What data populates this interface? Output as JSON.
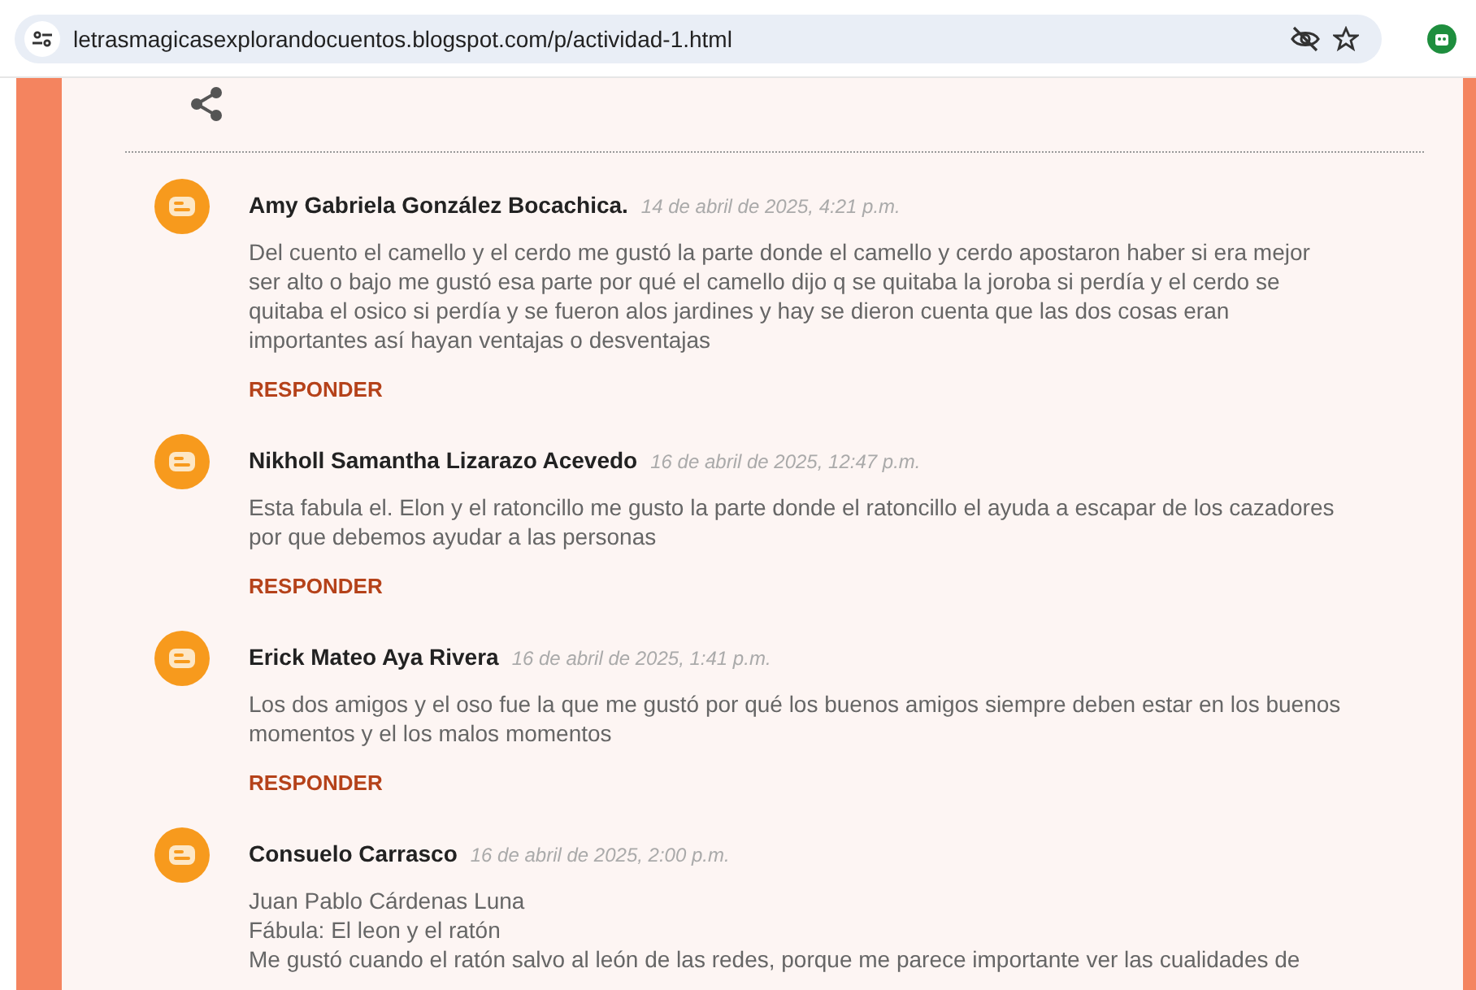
{
  "address_bar": {
    "url": "letrasmagicasexplorandocuentos.blogspot.com/p/actividad-1.html"
  },
  "comments": [
    {
      "author": "Amy Gabriela González Bocachica.",
      "date": "14 de abril de 2025, 4:21 p.m.",
      "text": "Del cuento el camello y el cerdo me gustó la parte donde el camello y cerdo apostaron haber si era mejor ser alto o bajo me gustó esa parte por qué el camello dijo q se quitaba la joroba si perdía y el cerdo se quitaba el osico si perdía y se fueron alos jardines y hay se dieron cuenta que las dos cosas eran importantes así hayan ventajas o desventajas",
      "reply": "RESPONDER"
    },
    {
      "author": "Nikholl Samantha Lizarazo Acevedo",
      "date": "16 de abril de 2025, 12:47 p.m.",
      "text": "Esta fabula el. Elon y el ratoncillo me gusto la parte donde el ratoncillo el ayuda a escapar de los cazadores por que debemos ayudar a las personas",
      "reply": "RESPONDER"
    },
    {
      "author": "Erick Mateo Aya Rivera",
      "date": "16 de abril de 2025, 1:41 p.m.",
      "text": "Los dos amigos y el oso fue la que me gustó por qué los buenos amigos siempre deben estar en los buenos momentos y el los malos momentos",
      "reply": "RESPONDER"
    },
    {
      "author": "Consuelo Carrasco",
      "date": "16 de abril de 2025, 2:00 p.m.",
      "lines": [
        "Juan Pablo Cárdenas Luna",
        "Fábula: El leon y el ratón",
        "Me gustó cuando el ratón salvo al león de las redes, porque me parece importante ver las cualidades de"
      ]
    }
  ]
}
